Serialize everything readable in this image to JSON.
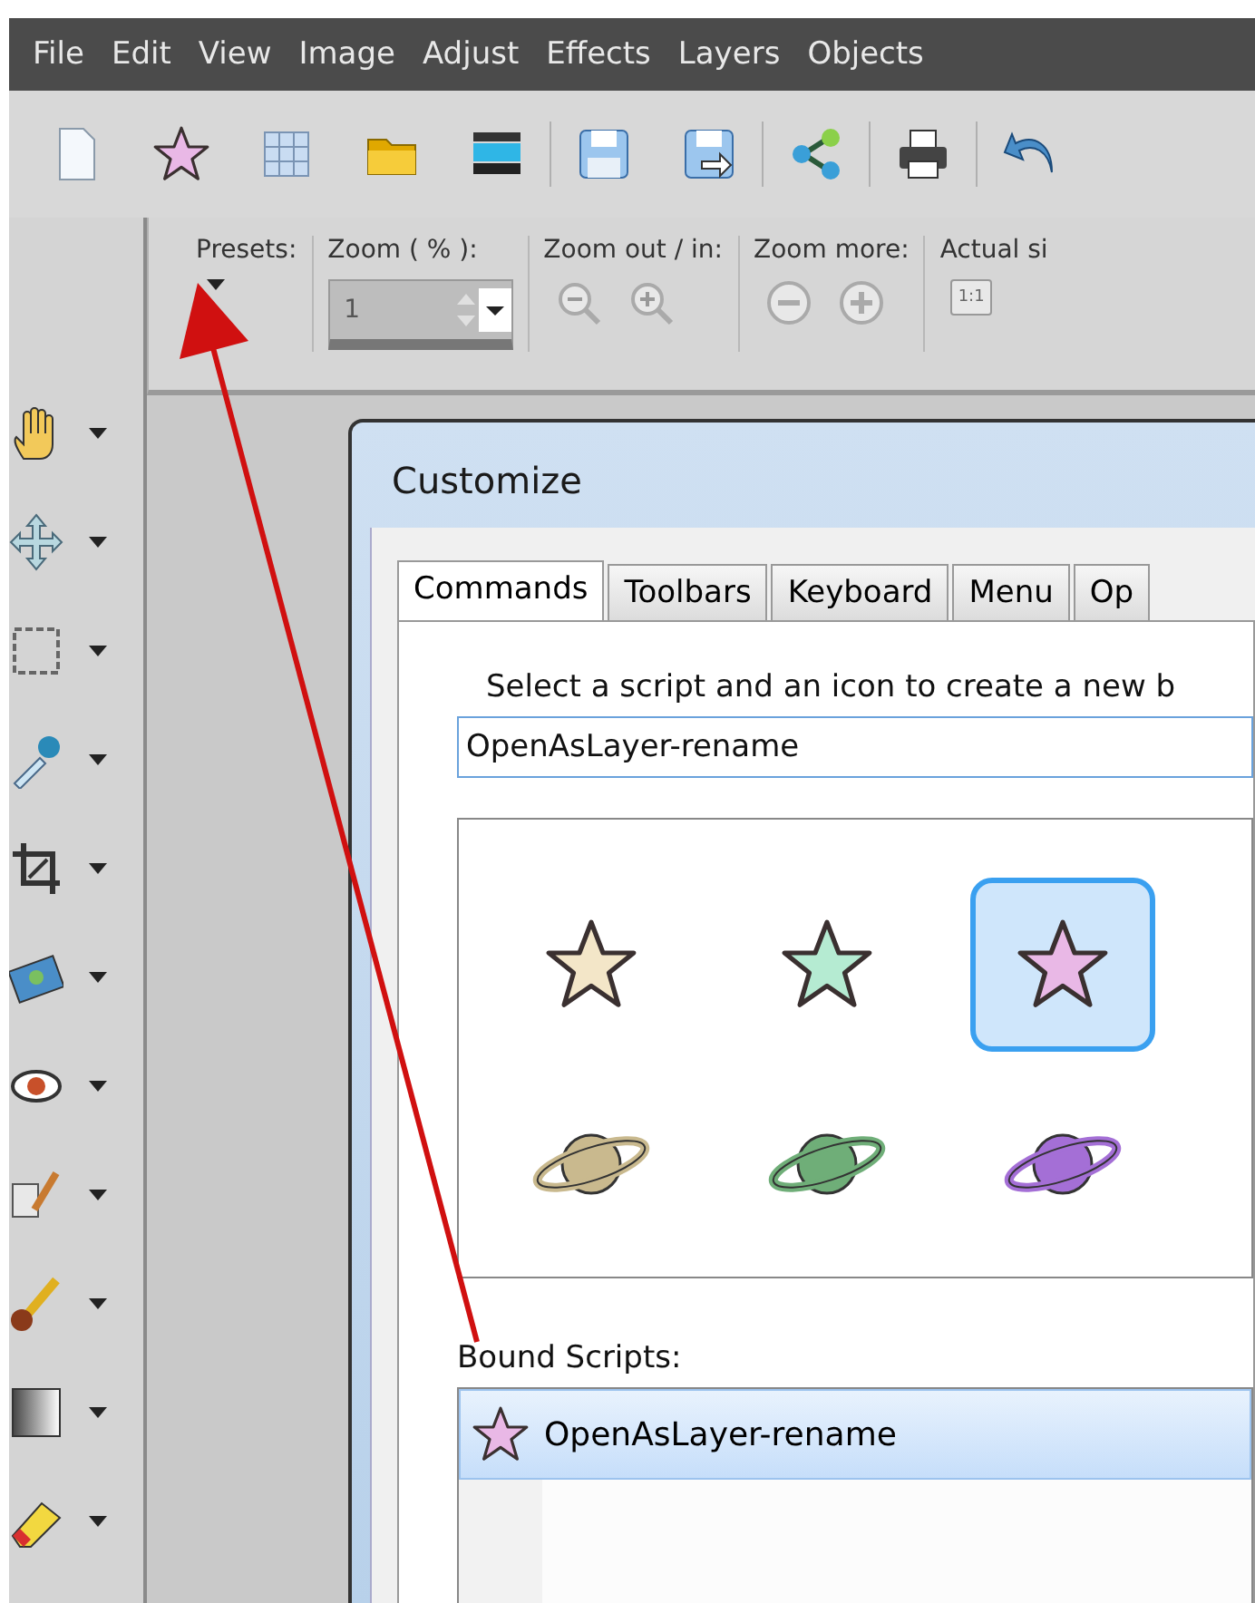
{
  "menu": [
    {
      "label": "File"
    },
    {
      "label": "Edit"
    },
    {
      "label": "View"
    },
    {
      "label": "Image"
    },
    {
      "label": "Adjust"
    },
    {
      "label": "Effects"
    },
    {
      "label": "Layers"
    },
    {
      "label": "Objects"
    }
  ],
  "toolbar": [
    {
      "kind": "new"
    },
    {
      "kind": "star"
    },
    {
      "kind": "grid"
    },
    {
      "kind": "folder"
    },
    {
      "kind": "scanner"
    },
    {
      "kind": "separator"
    },
    {
      "kind": "save"
    },
    {
      "kind": "saveas"
    },
    {
      "kind": "separator"
    },
    {
      "kind": "share"
    },
    {
      "kind": "separator"
    },
    {
      "kind": "print"
    },
    {
      "kind": "separator"
    },
    {
      "kind": "undo"
    }
  ],
  "options": {
    "presets_label": "Presets:",
    "zoom_label": "Zoom ( % ):",
    "zoom_value": "1",
    "zoom_out_in_label": "Zoom out / in:",
    "zoom_more_label": "Zoom more:",
    "actual_size_label": "Actual si",
    "actual_size_button": "1:1"
  },
  "tools": [
    {
      "kind": "hand"
    },
    {
      "kind": "move"
    },
    {
      "kind": "select"
    },
    {
      "kind": "dropper"
    },
    {
      "kind": "crop"
    },
    {
      "kind": "photo"
    },
    {
      "kind": "eye"
    },
    {
      "kind": "clone"
    },
    {
      "kind": "brush"
    },
    {
      "kind": "gradient"
    },
    {
      "kind": "eraser"
    }
  ],
  "dialog": {
    "title": "Customize",
    "tabs": [
      {
        "label": "Commands",
        "selected": true
      },
      {
        "label": "Toolbars",
        "selected": false
      },
      {
        "label": "Keyboard",
        "selected": false
      },
      {
        "label": "Menu",
        "selected": false
      },
      {
        "label": "Op",
        "selected": false
      }
    ],
    "group_label": "Select a script and an icon to create a new b",
    "script_value": "OpenAsLayer-rename",
    "icons": [
      {
        "kind": "star",
        "color": "#f3e6c8",
        "selected": false
      },
      {
        "kind": "star",
        "color": "#b5ebd2",
        "selected": false
      },
      {
        "kind": "star",
        "color": "#e9b8e6",
        "selected": true
      },
      {
        "kind": "planet",
        "color": "#c9b98e",
        "selected": false
      },
      {
        "kind": "planet",
        "color": "#6fae78",
        "selected": false
      },
      {
        "kind": "planet",
        "color": "#a46fd6",
        "selected": false
      }
    ],
    "bound_label": "Bound Scripts:",
    "bound_scripts": [
      {
        "label": "OpenAsLayer-rename",
        "selected": true
      }
    ]
  }
}
